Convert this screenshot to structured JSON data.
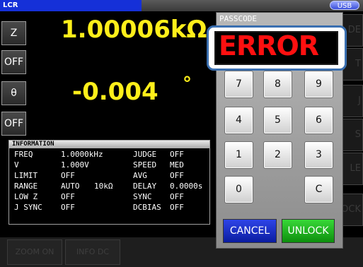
{
  "header": {
    "app_title": "LCR",
    "usb_label": "USB"
  },
  "side_buttons": [
    "Z",
    "OFF",
    "θ",
    "OFF"
  ],
  "measurement": {
    "primary_value": "1.00006kΩ",
    "secondary_value": "-0.004",
    "secondary_unit": "°"
  },
  "info": {
    "title": "INFORMATION",
    "rows": [
      [
        "FREQ",
        "1.0000kHz",
        "",
        "JUDGE",
        "OFF"
      ],
      [
        "V",
        "1.000V",
        "",
        "SPEED",
        "MED"
      ],
      [
        "LIMIT",
        "OFF",
        "",
        "AVG",
        "OFF"
      ],
      [
        "RANGE",
        "AUTO",
        "10kΩ",
        "DELAY",
        "0.0000s"
      ],
      [
        "LOW Z",
        "OFF",
        "",
        "SYNC",
        "OFF"
      ],
      [
        "J SYNC",
        "OFF",
        "",
        "DCBIAS",
        "OFF"
      ]
    ]
  },
  "ghost_buttons": [
    "DE",
    "T",
    "J",
    "S",
    "LE",
    "OCK"
  ],
  "bottom_buttons": [
    "ZOOM ON",
    "INFO DC"
  ],
  "dialog": {
    "title": "PASSCODE",
    "display_text": "ERROR",
    "keys": [
      "7",
      "8",
      "9",
      "4",
      "5",
      "6",
      "1",
      "2",
      "3",
      "0",
      "C"
    ],
    "cancel_label": "CANCEL",
    "unlock_label": "UNLOCK"
  }
}
